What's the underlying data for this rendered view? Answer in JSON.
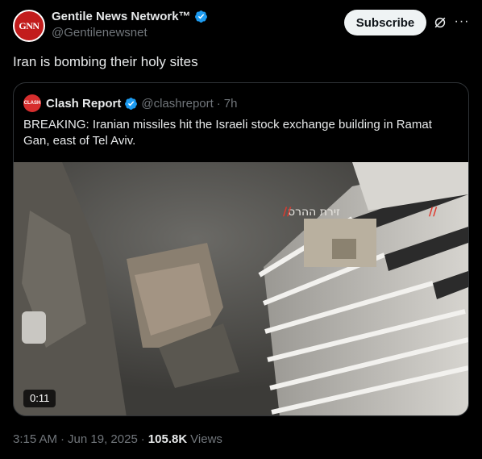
{
  "author": {
    "avatar_text": "GNN",
    "name": "Gentile News Network™",
    "handle": "@Gentilenewsnet",
    "verified": true
  },
  "actions": {
    "subscribe_label": "Subscribe",
    "grok_icon": "grok-icon",
    "more_icon": "more-icon"
  },
  "tweet": {
    "text": "Iran is bombing their holy sites"
  },
  "quote": {
    "avatar_text": "CLASH",
    "name": "Clash Report",
    "handle": "@clashreport",
    "separator": "·",
    "time": "7h",
    "text": "BREAKING: Iranian missiles hit the Israeli stock exchange building in Ramat Gan, east of Tel Aviv.",
    "video": {
      "duration": "0:11",
      "overlay_text": "זירת ההרס"
    }
  },
  "footer": {
    "time": "3:15 AM",
    "sep1": "·",
    "date": "Jun 19, 2025",
    "sep2": "·",
    "views_count": "105.8K",
    "views_label": "Views"
  },
  "colors": {
    "background": "#000000",
    "text": "#e7e9ea",
    "muted": "#71767b",
    "verified_blue": "#1d9bf0",
    "border": "#2f3336"
  }
}
